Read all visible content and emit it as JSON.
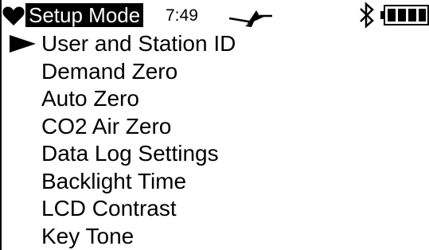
{
  "status_bar": {
    "mode_title": "Setup Mode",
    "time": "7:49",
    "icons": {
      "left": "heart-icon",
      "signal": "signal-icon",
      "bluetooth": "bluetooth-icon",
      "battery": "battery-icon"
    },
    "battery_level": 1.0
  },
  "menu": {
    "selector_icon": "selector-arrow-icon",
    "selected_index": 0,
    "items": [
      {
        "label": "User and Station ID"
      },
      {
        "label": "Demand Zero"
      },
      {
        "label": "Auto Zero"
      },
      {
        "label": "CO2 Air Zero"
      },
      {
        "label": "Data Log Settings"
      },
      {
        "label": "Backlight Time"
      },
      {
        "label": "LCD Contrast"
      },
      {
        "label": "Key Tone"
      }
    ]
  },
  "colors": {
    "foreground": "#000000",
    "background": "#ffffff",
    "highlight_text": "#ffffff"
  }
}
